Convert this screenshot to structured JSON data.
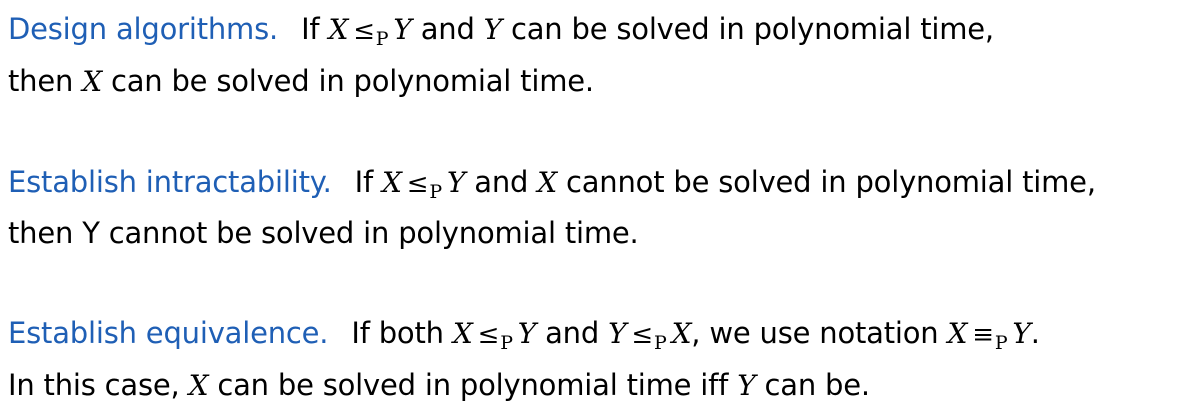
{
  "blocks": [
    {
      "lead": "Design algorithms.",
      "line1": [
        {
          "t": "If "
        },
        {
          "v": "X"
        },
        {
          "rel": "≤",
          "sub": "P"
        },
        {
          "v": "Y"
        },
        {
          "t": " and "
        },
        {
          "v": "Y"
        },
        {
          "t": " can be solved in polynomial time,"
        }
      ],
      "line2": [
        {
          "t": "then "
        },
        {
          "v": "X"
        },
        {
          "t": " can be solved in polynomial time."
        }
      ]
    },
    {
      "lead": "Establish intractability.",
      "line1": [
        {
          "t": "If "
        },
        {
          "v": "X"
        },
        {
          "rel": "≤",
          "sub": "P"
        },
        {
          "v": "Y"
        },
        {
          "t": " and "
        },
        {
          "v": "X"
        },
        {
          "t": " cannot be solved in polynomial time,"
        }
      ],
      "line2": [
        {
          "t": "then Y cannot be solved in polynomial time."
        }
      ]
    },
    {
      "lead": "Establish equivalence.",
      "line1": [
        {
          "t": "If both "
        },
        {
          "v": "X"
        },
        {
          "rel": "≤",
          "sub": "P"
        },
        {
          "v": "Y"
        },
        {
          "t": " and "
        },
        {
          "v": "Y"
        },
        {
          "rel": "≤",
          "sub": "P"
        },
        {
          "v": "X"
        },
        {
          "t": ", we use notation "
        },
        {
          "v": "X"
        },
        {
          "rel": "≡",
          "sub": "P"
        },
        {
          "v": "Y"
        },
        {
          "t": "."
        }
      ],
      "line2": [
        {
          "t": "In this case, "
        },
        {
          "v": "X"
        },
        {
          "t": " can be solved in polynomial time iff "
        },
        {
          "v": "Y"
        },
        {
          "t": " can be."
        }
      ]
    }
  ]
}
